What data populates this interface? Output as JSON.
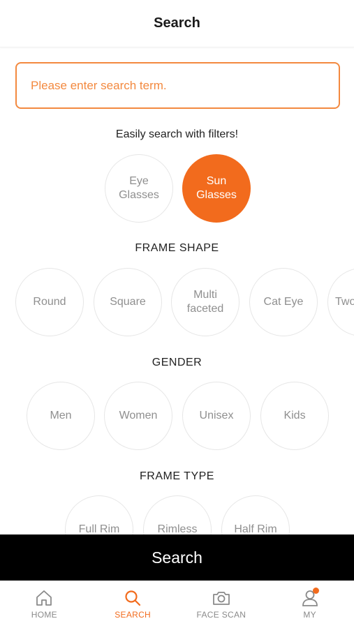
{
  "header": {
    "title": "Search"
  },
  "search": {
    "placeholder": "Please enter search term."
  },
  "filters_hint": "Easily search with filters!",
  "lens_types": [
    {
      "label": "Eye\nGlasses",
      "selected": false
    },
    {
      "label": "Sun\nGlasses",
      "selected": true
    }
  ],
  "frame_shape": {
    "title": "FRAME SHAPE",
    "options": [
      "Round",
      "Square",
      "Multi\nfaceted",
      "Cat Eye",
      "Two"
    ]
  },
  "gender": {
    "title": "GENDER",
    "options": [
      "Men",
      "Women",
      "Unisex",
      "Kids"
    ]
  },
  "frame_type": {
    "title": "FRAME TYPE",
    "options": [
      "Full Rim",
      "Rimless",
      "Half Rim"
    ]
  },
  "search_button": "Search",
  "tabbar": {
    "items": [
      {
        "label": "HOME",
        "icon": "home-icon",
        "active": false
      },
      {
        "label": "SEARCH",
        "icon": "search-icon",
        "active": true
      },
      {
        "label": "FACE SCAN",
        "icon": "camera-icon",
        "active": false
      },
      {
        "label": "MY",
        "icon": "user-icon",
        "active": false,
        "notification": true
      }
    ]
  },
  "colors": {
    "accent": "#f26b1d",
    "accent_light": "#f3893f",
    "bar": "#000000"
  }
}
